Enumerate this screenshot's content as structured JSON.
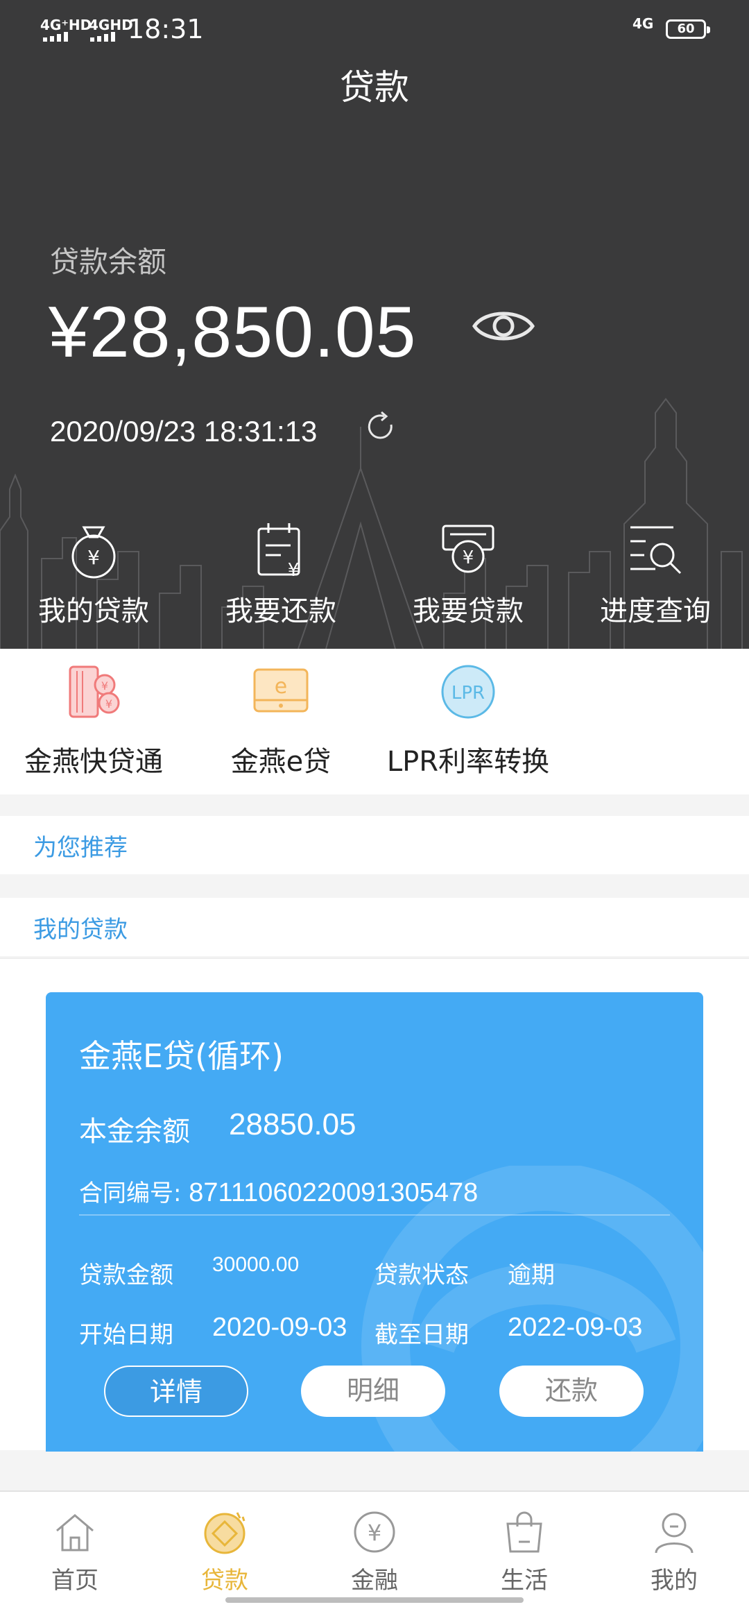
{
  "status_bar": {
    "signal_1": "4G⁺HD",
    "signal_2": "4GHD",
    "time": "18:31",
    "network_right": "4G",
    "battery": "60"
  },
  "header": {
    "title": "贷款"
  },
  "balance": {
    "label": "贷款余额",
    "amount": "¥28,850.05",
    "timestamp": "2020/09/23 18:31:13"
  },
  "quick_actions": [
    {
      "label": "我的贷款",
      "icon": "money-bag-icon"
    },
    {
      "label": "我要还款",
      "icon": "repay-calendar-icon"
    },
    {
      "label": "我要贷款",
      "icon": "apply-loan-icon"
    },
    {
      "label": "进度查询",
      "icon": "progress-search-icon"
    }
  ],
  "services": [
    {
      "label": "金燕快贷通",
      "icon": "cards-yen-icon",
      "color": "#f07a7a"
    },
    {
      "label": "金燕e贷",
      "icon": "e-loan-icon",
      "color": "#f3b55a"
    },
    {
      "label": "LPR利率转换",
      "icon": "lpr-icon",
      "icon_text": "LPR",
      "color": "#5bb9e6"
    }
  ],
  "sections": {
    "recommend": "为您推荐",
    "my_loans": "我的贷款"
  },
  "loan_card": {
    "title": "金燕E贷(循环)",
    "principal_label": "本金余额",
    "principal_value": "28850.05",
    "contract_label": "合同编号:",
    "contract_no": "87111060220091305478",
    "loan_amount_label": "贷款金额",
    "loan_amount": "30000.00",
    "status_label": "贷款状态",
    "status": "逾期",
    "start_label": "开始日期",
    "start_date": "2020-09-03",
    "end_label": "截至日期",
    "end_date": "2022-09-03",
    "buttons": {
      "details": "详情",
      "breakdown": "明细",
      "repay": "还款"
    },
    "color": "#44aaf4"
  },
  "bottom_nav": [
    {
      "label": "首页",
      "icon": "home-icon",
      "active": false
    },
    {
      "label": "贷款",
      "icon": "loan-coin-icon",
      "active": true
    },
    {
      "label": "金融",
      "icon": "finance-yen-icon",
      "active": false
    },
    {
      "label": "生活",
      "icon": "shopping-bag-icon",
      "active": false
    },
    {
      "label": "我的",
      "icon": "profile-icon",
      "active": false
    }
  ],
  "colors": {
    "header_bg": "#3a3a3b",
    "accent_blue": "#3c9be3",
    "active_gold": "#e8b63a"
  }
}
